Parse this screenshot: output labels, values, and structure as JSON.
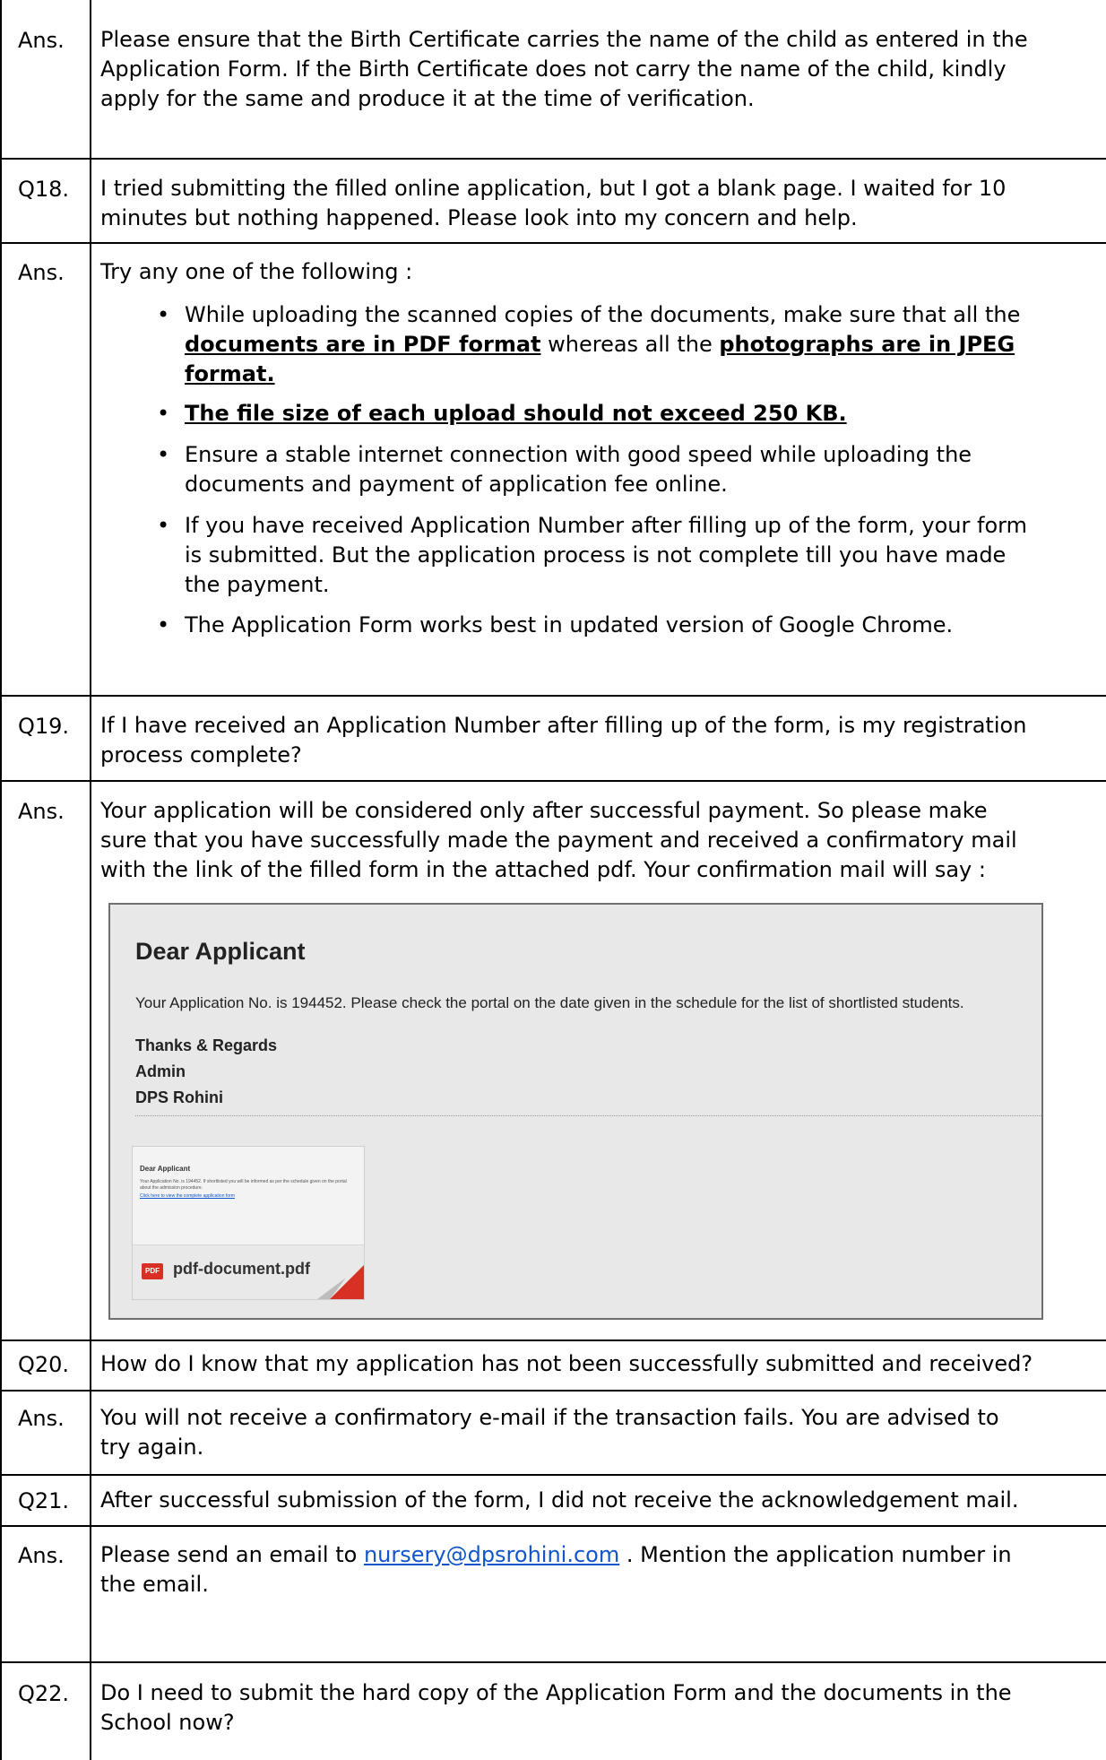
{
  "rows": [
    {
      "label": "Ans.",
      "lines": [
        "Please ensure that the Birth Certificate carries the name of the child as entered in the",
        "Application Form. If the Birth Certificate does not carry the name of the child, kindly",
        "apply for the same and produce it at the time of verification."
      ]
    },
    {
      "label": "Q18.",
      "lines": [
        "I tried submitting the filled online application, but I got a blank page. I waited for 10",
        "minutes but nothing happened. Please look into my concern and help."
      ]
    },
    {
      "label": "Ans.",
      "intro": "Try any one of the following :",
      "bullets": [
        {
          "l1a": "While uploading the scanned copies of the documents, make sure that all the",
          "l2a": "documents are in PDF format",
          "l2b": " whereas all the ",
          "l2c": "photographs are in JPEG",
          "l3a": "format."
        },
        {
          "text": "The file size of each upload should not exceed 250 KB."
        },
        {
          "lines": [
            "Ensure a stable internet connection with good speed while uploading the",
            "documents and payment of application fee online."
          ]
        },
        {
          "lines": [
            "If you have received Application Number after filling up of the form, your form",
            "is submitted. But the application process is not complete till you have made",
            "the payment."
          ]
        },
        {
          "text": "The Application Form works best in updated version of Google Chrome."
        }
      ]
    },
    {
      "label": "Q19.",
      "lines": [
        "If I have received an Application Number after filling up of the form, is my registration",
        "process complete?"
      ]
    },
    {
      "label": "Ans.",
      "lines": [
        "Your application will be considered only after successful payment. So please make",
        "sure that you have successfully made the payment and received a confirmatory mail",
        "with the link of the filled form in the attached pdf. Your confirmation mail will say :"
      ]
    },
    {
      "label": "Q20.",
      "lines": [
        "How do I know that my application has not been successfully submitted and received?"
      ]
    },
    {
      "label": "Ans.",
      "lines": [
        "You will not receive a confirmatory e-mail if the transaction fails. You are advised to",
        "try again."
      ]
    },
    {
      "label": "Q21.",
      "lines": [
        "After successful submission of the form, I did not receive the acknowledgement mail."
      ]
    },
    {
      "label": "Ans.",
      "pre": "Please send an email to ",
      "link": "nursery@dpsrohini.com",
      "post": " . Mention the application number in",
      "line2": "the email."
    },
    {
      "label": "Q22.",
      "lines": [
        "Do I need to submit the hard copy of the Application Form and the documents in the",
        "School now?"
      ]
    }
  ],
  "mail": {
    "title": "Dear Applicant",
    "message": "Your Application No. is 194452. Please check the portal on the date given in the schedule for the list of shortlisted students.",
    "sign": [
      "Thanks & Regards",
      "Admin",
      "DPS Rohini"
    ],
    "thumb_title": "Dear Applicant",
    "thumb_body": "Your Application No. is 194452. If shortlisted you will be informed as per the schedule given on the portal about the admission procedure.",
    "thumb_link": "Click here to view the complete application form",
    "pdf_label": "PDF",
    "attachment": "pdf-document.pdf"
  }
}
